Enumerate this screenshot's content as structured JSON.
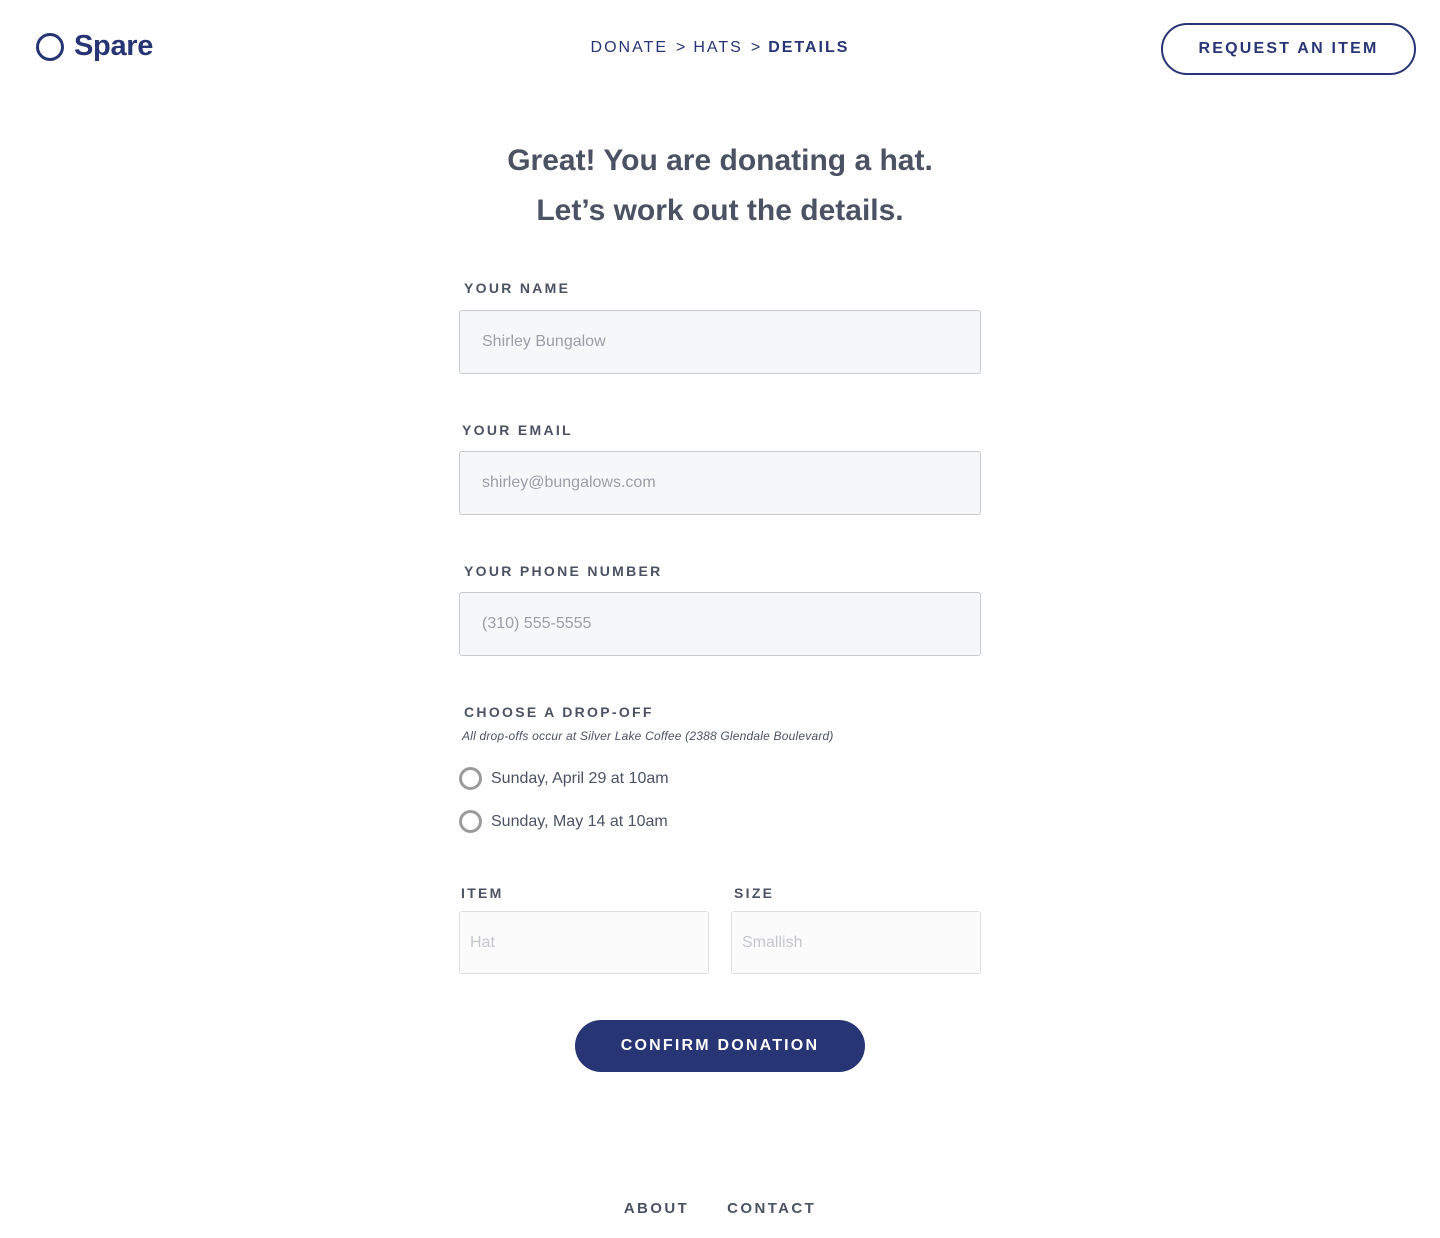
{
  "brand": {
    "name": "Spare",
    "color": "#273574"
  },
  "breadcrumb": {
    "items": [
      "DONATE",
      "HATS",
      "DETAILS"
    ],
    "separator": ">"
  },
  "header": {
    "request_label": "REQUEST AN ITEM"
  },
  "heading": {
    "line1": "Great! You are donating a hat.",
    "line2": "Let’s work out the details."
  },
  "form": {
    "name": {
      "label": "YOUR NAME",
      "placeholder": "Shirley Bungalow",
      "value": ""
    },
    "email": {
      "label": "YOUR EMAIL",
      "placeholder": "shirley@bungalows.com",
      "value": ""
    },
    "phone": {
      "label": "YOUR PHONE NUMBER",
      "placeholder": "(310) 555-5555",
      "value": ""
    },
    "dropoff": {
      "label": "CHOOSE A DROP-OFF",
      "note": "All drop-offs occur at Silver Lake Coffee (2388 Glendale Boulevard)",
      "options": [
        {
          "label": "Sunday, April 29 at 10am",
          "selected": false
        },
        {
          "label": "Sunday, May 14 at 10am",
          "selected": false
        }
      ]
    },
    "item": {
      "label": "ITEM",
      "placeholder": "Hat"
    },
    "size": {
      "label": "SIZE",
      "placeholder": "Smallish"
    },
    "confirm_label": "CONFIRM DONATION"
  },
  "footer": {
    "links": [
      "ABOUT",
      "CONTACT"
    ]
  }
}
